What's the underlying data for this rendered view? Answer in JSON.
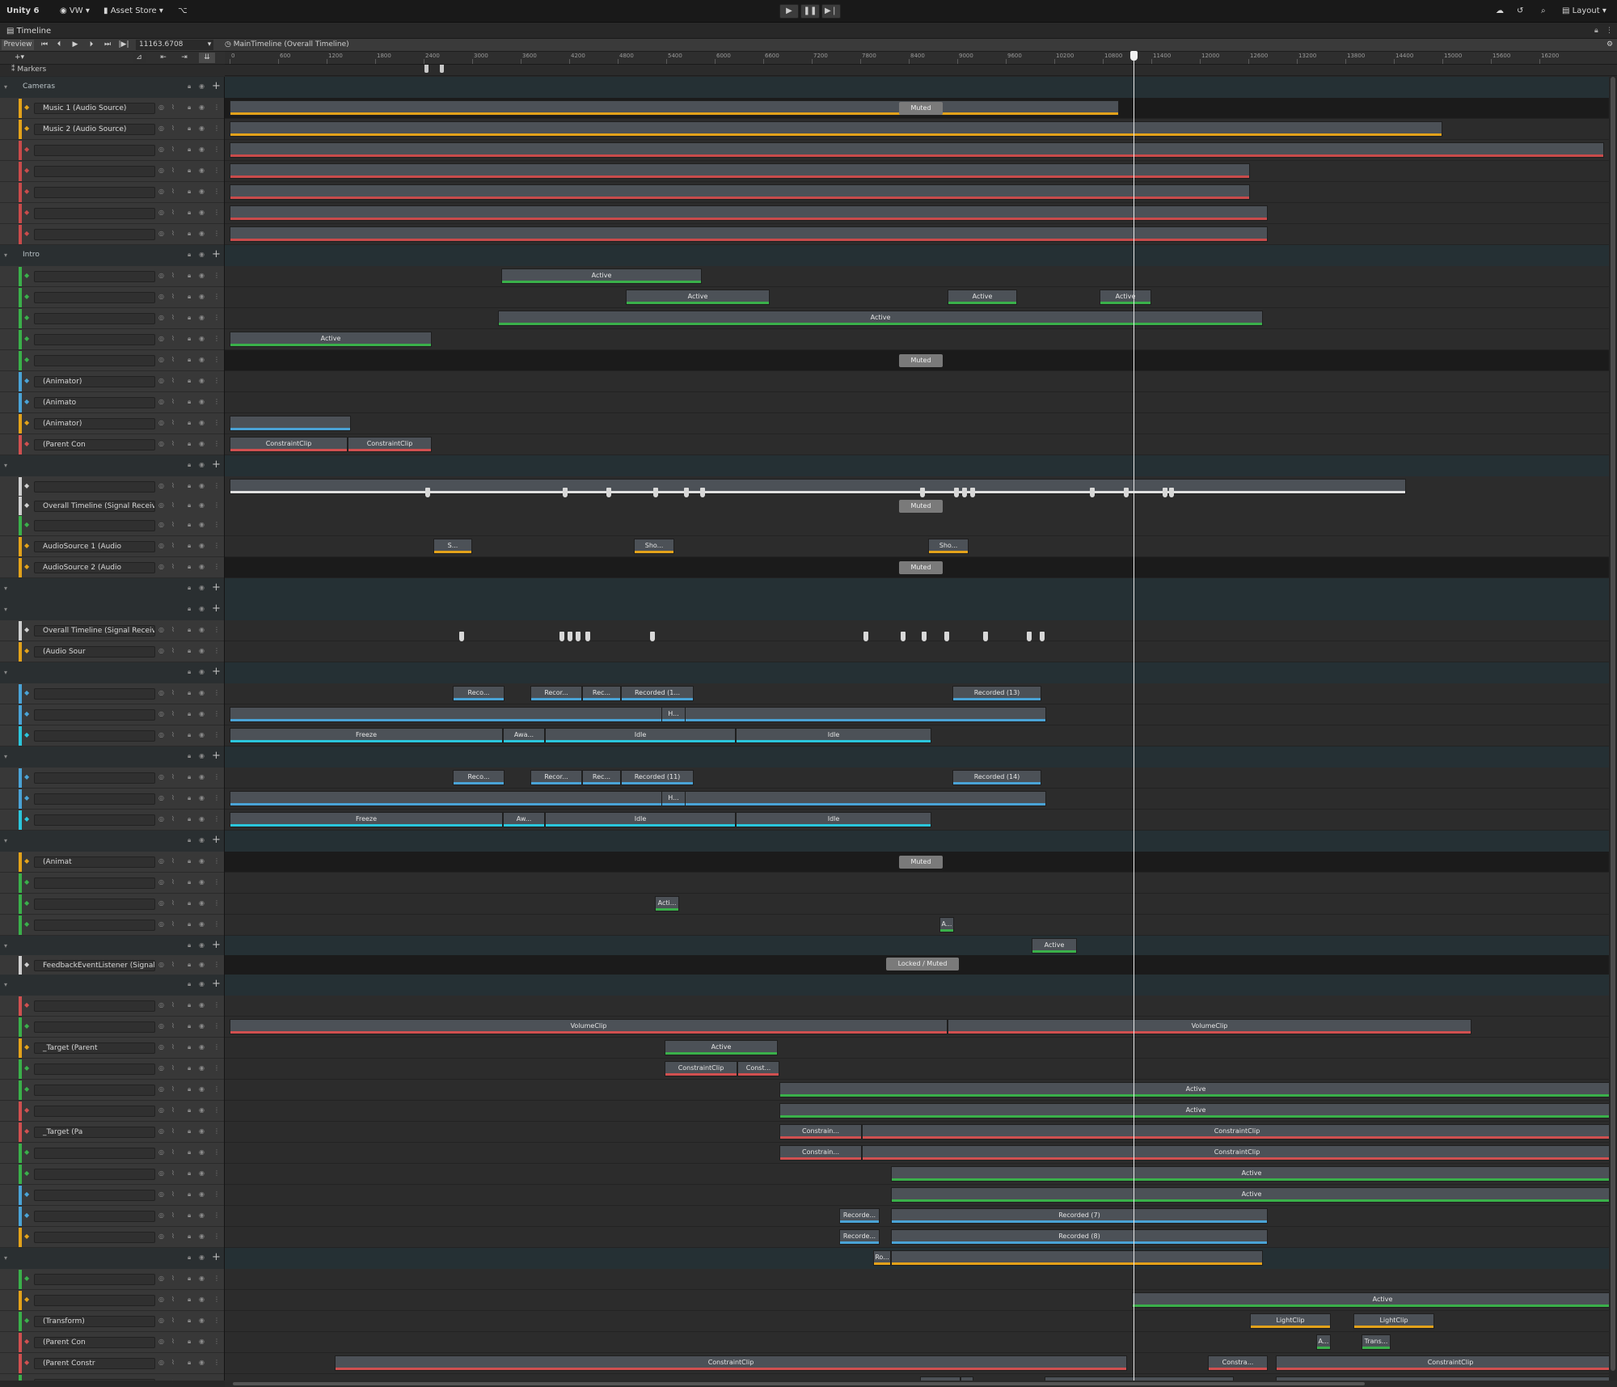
{
  "topbar": {
    "app_title": "Unity 6",
    "account_label": "VW",
    "asset_store_label": "Asset Store",
    "layout_label": "Layout",
    "play_icon": "play-icon",
    "pause_icon": "pause-icon",
    "step_icon": "step-icon"
  },
  "window": {
    "tab_title": "Timeline"
  },
  "timeline_toolbar": {
    "preview_label": "Preview",
    "time_value": "11163.6708",
    "breadcrumb": "MainTimeline (Overall Timeline)"
  },
  "markers_label": "Markers",
  "ruler_ticks": [
    "0",
    "600",
    "1200",
    "1800",
    "2400",
    "3000",
    "3600",
    "4200",
    "4800",
    "5400",
    "6000",
    "6600",
    "7200",
    "7800",
    "8400",
    "9000",
    "9600",
    "10200",
    "10800",
    "11400",
    "12000",
    "12600",
    "13200",
    "13800",
    "14400",
    "15000",
    "15600",
    "16200"
  ],
  "colors": {
    "audio": "#e3a21a",
    "cinemachine": "#c94b4b",
    "activation": "#3ab04a",
    "animation": "#4aa3d6",
    "signal": "#cfcfcf",
    "constraint": "#d05050",
    "cyan": "#2bc6dc",
    "muted_bg": "#1b1b1b"
  },
  "groups": {
    "cameras": "Cameras",
    "intro": "Intro"
  },
  "tracks": {
    "music1": "Music 1 (Audio Source)",
    "music2": "Music 2 (Audio Source)",
    "animator1": "(Animator)",
    "animator2": "(Animato",
    "animator3": "(Animator)",
    "parent_con": "(Parent Con",
    "signal_receive_1": "Overall Timeline (Signal Receive",
    "audio_source_1": "AudioSource 1 (Audio",
    "audio_source_2": "AudioSource 2 (Audio",
    "signal_receive_2": "Overall Timeline (Signal Receive",
    "audio_sour": "(Audio Sour",
    "animate": "(Animat",
    "feedback_listener": "FeedbackEventListener (Signal",
    "target_parent_1": "_Target (Parent",
    "target_pa": "_Target (Pa",
    "transform": "(Transform)",
    "parent_con2": "(Parent Con",
    "parent_constr": "(Parent Constr"
  },
  "clips": {
    "muted": "Muted",
    "active": "Active",
    "constraint": "ConstraintClip",
    "freeze": "Freeze",
    "idle": "Idle",
    "awa": "Awa...",
    "aw": "Aw...",
    "reco": "Reco...",
    "recor": "Recor...",
    "rec": "Rec...",
    "recorded_1": "Recorded (1...",
    "recorded_13": "Recorded (13)",
    "recorded_11": "Recorded (11)",
    "recorded_14": "Recorded (14)",
    "recorded_7": "Recorded (7)",
    "recorded_8": "Recorded (8)",
    "recorde": "Recorde...",
    "h": "H...",
    "acti": "Acti...",
    "a": "A...",
    "locked_muted": "Locked / Muted",
    "volume_clip": "VolumeClip",
    "const": "Const...",
    "constrain": "Constrain...",
    "constra": "Constra...",
    "light_clip": "LightClip",
    "trans": "Trans...",
    "ro": "Ro...",
    "sho": "Sho...",
    "s": "S..."
  }
}
